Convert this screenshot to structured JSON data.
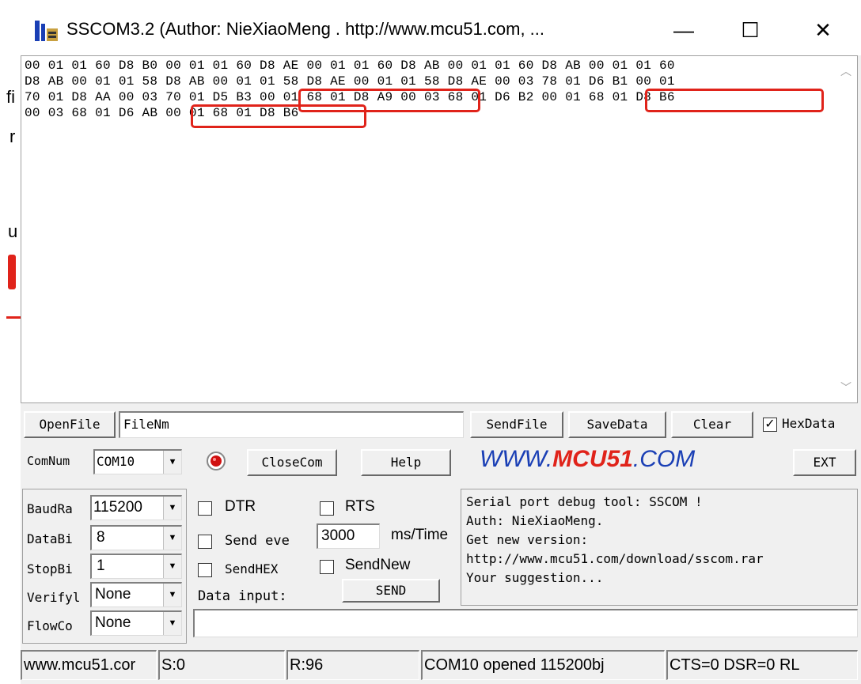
{
  "window": {
    "title": "SSCOM3.2 (Author: NieXiaoMeng .  http://www.mcu51.com,  ...",
    "minimize": "—",
    "maximize": "☐",
    "close": "✕"
  },
  "background_window": {
    "fragments": [
      "fi",
      "r",
      "u"
    ]
  },
  "receive": {
    "lines": [
      "00 01 01 60 D8 B0 00 01 01 60 D8 AE 00 01 01 60 D8 AB 00 01 01 60 D8 AB 00 01 01 60",
      "D8 AB 00 01 01 58 D8 AB 00 01 01 58 D8 AE 00 01 01 58 D8 AE 00 03 78 01 D6 B1 00 01",
      "70 01 D8 AA 00 03 70 01 D5 B3 00 01 68 01 D8 A9 00 03 68 01 D6 B2 00 01 68 01 D8 B6",
      "00 03 68 01 D6 AB 00 01 68 01 D8 B6"
    ],
    "highlight_color": "#e0231a"
  },
  "toolbar": {
    "openfile": "OpenFile",
    "filename_value": "FileNm",
    "sendfile": "SendFile",
    "savedata": "SaveData",
    "clear": "Clear",
    "hexdata_label": "HexData",
    "hexdata_checked": true,
    "comnum_label": "ComNum",
    "comnum_value": "COM10",
    "closecom": "CloseCom",
    "help": "Help",
    "logo_www": "WWW.",
    "logo_mcu": "MCU51",
    "logo_com": ".COM",
    "ext": "EXT"
  },
  "settings": {
    "baud_label": "BaudRa",
    "baud_value": "115200",
    "databits_label": "DataBi",
    "databits_value": "8",
    "stopbits_label": "StopBi",
    "stopbits_value": "1",
    "verify_label": "Verifyl",
    "verify_value": "None",
    "flow_label": "FlowCo",
    "flow_value": "None",
    "dtr": "DTR",
    "rts": "RTS",
    "send_every": "Send eve",
    "interval_value": "3000",
    "interval_unit": "ms/Time",
    "sendhex": "SendHEX",
    "sendnew": "SendNew",
    "data_input_label": "Data input:",
    "send": "SEND"
  },
  "info": {
    "lines": [
      "Serial port debug tool: SSCOM !",
      "Auth: NieXiaoMeng.",
      "Get new version:",
      "http://www.mcu51.com/download/sscom.rar",
      "Your suggestion..."
    ]
  },
  "statusbar": {
    "site": "www.mcu51.cor",
    "sent": "S:0",
    "received": "R:96",
    "port_status": "COM10 opened 115200bj",
    "lines": "CTS=0 DSR=0 RL"
  },
  "colors": {
    "logo_blue": "#1a3fb5",
    "logo_red": "#e0231a",
    "led_red": "#d01010"
  }
}
